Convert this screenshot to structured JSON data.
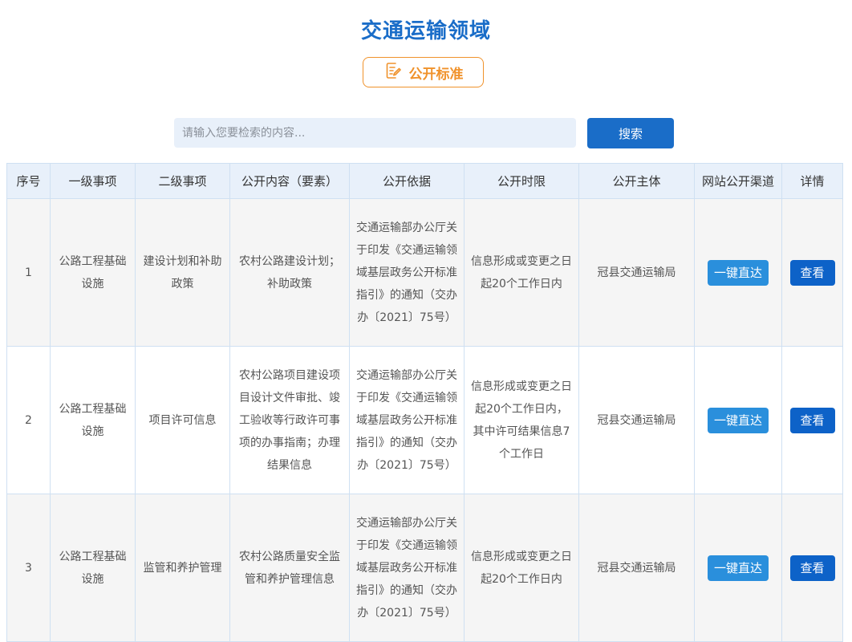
{
  "page": {
    "title": "交通运输领域",
    "standard_button": "公开标准"
  },
  "search": {
    "placeholder": "请输入您要检索的内容...",
    "button": "搜索"
  },
  "table": {
    "headers": [
      "序号",
      "一级事项",
      "二级事项",
      "公开内容（要素）",
      "公开依据",
      "公开时限",
      "公开主体",
      "网站公开渠道",
      "详情"
    ],
    "rows": [
      {
        "index": "1",
        "level1": "公路工程基础设施",
        "level2": "建设计划和补助政策",
        "content": "农村公路建设计划；补助政策",
        "basis": "交通运输部办公厅关于印发《交通运输领域基层政务公开标准指引》的通知（交办办〔2021〕75号）",
        "deadline": "信息形成或变更之日起20个工作日内",
        "subject": "冠县交通运输局",
        "channel": "一键直达",
        "detail": "查看"
      },
      {
        "index": "2",
        "level1": "公路工程基础设施",
        "level2": "项目许可信息",
        "content": "农村公路项目建设项目设计文件审批、竣工验收等行政许可事项的办事指南；办理结果信息",
        "basis": "交通运输部办公厅关于印发《交通运输领域基层政务公开标准指引》的通知（交办办〔2021〕75号）",
        "deadline": "信息形成或变更之日起20个工作日内，其中许可结果信息7个工作日",
        "subject": "冠县交通运输局",
        "channel": "一键直达",
        "detail": "查看"
      },
      {
        "index": "3",
        "level1": "公路工程基础设施",
        "level2": "监管和养护管理",
        "content": "农村公路质量安全监管和养护管理信息",
        "basis": "交通运输部办公厅关于印发《交通运输领域基层政务公开标准指引》的通知（交办办〔2021〕75号）",
        "deadline": "信息形成或变更之日起20个工作日内",
        "subject": "冠县交通运输局",
        "channel": "一键直达",
        "detail": "查看"
      }
    ]
  },
  "colors": {
    "title": "#1a6dc8",
    "accent_orange": "#f0922b",
    "search_bg": "#e8f0fa",
    "primary_button": "#1a6dc8",
    "direct_button": "#2a8fdc",
    "view_button": "#0d62c8"
  },
  "icons": {
    "standard_button_icon": "document-edit-icon"
  }
}
